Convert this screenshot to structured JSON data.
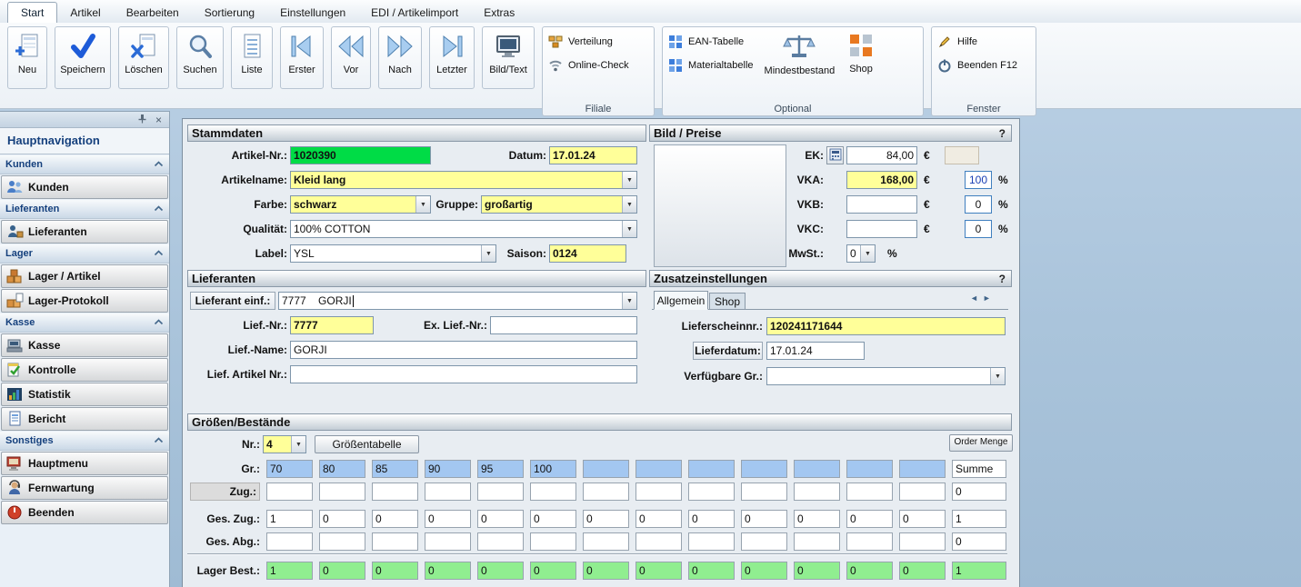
{
  "menu": {
    "items": [
      "Start",
      "Artikel",
      "Bearbeiten",
      "Sortierung",
      "Einstellungen",
      "EDI / Artikelimport",
      "Extras"
    ]
  },
  "ribbon": {
    "buttons": [
      {
        "label": "Neu",
        "icon": "new-form-icon"
      },
      {
        "label": "Speichern",
        "icon": "save-check-icon"
      },
      {
        "label": "Löschen",
        "icon": "delete-icon"
      },
      {
        "label": "Suchen",
        "icon": "search-icon"
      },
      {
        "label": "Liste",
        "icon": "list-icon"
      },
      {
        "label": "Erster",
        "icon": "first-record-icon"
      },
      {
        "label": "Vor",
        "icon": "previous-record-icon"
      },
      {
        "label": "Nach",
        "icon": "next-record-icon"
      },
      {
        "label": "Letzter",
        "icon": "last-record-icon"
      },
      {
        "label": "Bild/Text",
        "icon": "image-text-icon"
      }
    ],
    "groups": [
      {
        "caption": "Filiale",
        "items": [
          {
            "label": "Verteilung",
            "icon": "distribution-icon"
          },
          {
            "label": "Online-Check",
            "icon": "online-check-icon"
          }
        ]
      },
      {
        "caption": "Optional",
        "items": [
          {
            "label": "EAN-Tabelle",
            "icon": "ean-table-icon"
          },
          {
            "label": "Materialtabelle",
            "icon": "material-table-icon"
          },
          {
            "label": "Mindestbestand",
            "icon": "scales-icon"
          },
          {
            "label": "Shop",
            "icon": "shop-grid-icon"
          }
        ]
      },
      {
        "caption": "Fenster",
        "items": [
          {
            "label": "Hilfe",
            "icon": "help-pen-icon"
          },
          {
            "label": "Beenden F12",
            "icon": "power-icon"
          }
        ]
      }
    ]
  },
  "sidebar": {
    "title": "Hauptnavigation",
    "sections": [
      {
        "header": "Kunden",
        "items": [
          {
            "label": "Kunden",
            "icon": "customers-icon"
          }
        ]
      },
      {
        "header": "Lieferanten",
        "items": [
          {
            "label": "Lieferanten",
            "icon": "suppliers-icon"
          }
        ]
      },
      {
        "header": "Lager",
        "items": [
          {
            "label": "Lager / Artikel",
            "icon": "warehouse-icon"
          },
          {
            "label": "Lager-Protokoll",
            "icon": "warehouse-log-icon"
          }
        ]
      },
      {
        "header": "Kasse",
        "items": [
          {
            "label": "Kasse",
            "icon": "cash-register-icon"
          },
          {
            "label": "Kontrolle",
            "icon": "control-icon"
          },
          {
            "label": "Statistik",
            "icon": "statistics-icon"
          },
          {
            "label": "Bericht",
            "icon": "report-icon"
          }
        ]
      },
      {
        "header": "Sonstiges",
        "items": [
          {
            "label": "Hauptmenu",
            "icon": "main-menu-icon"
          },
          {
            "label": "Fernwartung",
            "icon": "remote-support-icon"
          },
          {
            "label": "Beenden",
            "icon": "quit-icon"
          }
        ]
      }
    ]
  },
  "stammdaten": {
    "title": "Stammdaten",
    "artikel_nr_label": "Artikel-Nr.:",
    "artikel_nr": "1020390",
    "datum_label": "Datum:",
    "datum": "17.01.24",
    "artikelname_label": "Artikelname:",
    "artikelname": "Kleid lang",
    "farbe_label": "Farbe:",
    "farbe": "schwarz",
    "gruppe_label": "Gruppe:",
    "gruppe": "großartig",
    "qualitaet_label": "Qualität:",
    "qualitaet": "100% COTTON",
    "label_label": "Label:",
    "label": "YSL",
    "saison_label": "Saison:",
    "saison": "0124"
  },
  "bild_preise": {
    "title": "Bild / Preise",
    "help": "?",
    "ek_label": "EK:",
    "ek": "84,00",
    "vka_label": "VKA:",
    "vka": "168,00",
    "vka_pct": "100",
    "vkb_label": "VKB:",
    "vkb": "",
    "vkb_pct": "0",
    "vkc_label": "VKC:",
    "vkc": "",
    "vkc_pct": "0",
    "mwst_label": "MwSt.:",
    "mwst": "0",
    "euro": "€",
    "percent": "%"
  },
  "lieferanten": {
    "title": "Lieferanten",
    "einf_label": "Lieferant einf.:",
    "einf_value": "7777    GORJI",
    "nr_label": "Lief.-Nr.:",
    "nr": "7777",
    "ex_nr_label": "Ex. Lief.-Nr.:",
    "ex_nr": "",
    "name_label": "Lief.-Name:",
    "name": "GORJI",
    "artikel_nr_label": "Lief. Artikel Nr.:",
    "artikel_nr": ""
  },
  "zusatz": {
    "title": "Zusatzeinstellungen",
    "help": "?",
    "tab_allgemein": "Allgemein",
    "tab_shop": "Shop",
    "lieferschein_label": "Lieferscheinnr.:",
    "lieferschein": "120241171644",
    "lieferdatum_label": "Lieferdatum:",
    "lieferdatum": "17.01.24",
    "verfuegbar_label": "Verfügbare Gr.:",
    "verfuegbar": ""
  },
  "groessen": {
    "title": "Größen/Bestände",
    "nr_label": "Nr.:",
    "nr": "4",
    "groessentabelle_button": "Größentabelle",
    "order_menge_button": "Order Menge",
    "grid_rows": [
      {
        "label": "Gr.:",
        "cell_style": "blue",
        "cells": [
          "70",
          "80",
          "85",
          "90",
          "95",
          "100",
          "",
          "",
          "",
          "",
          "",
          "",
          ""
        ],
        "summe": "Summe",
        "summe_style": "header"
      },
      {
        "label": "Zug.:",
        "cell_style": "white",
        "label_boxed": true,
        "cells": [
          "",
          "",
          "",
          "",
          "",
          "",
          "",
          "",
          "",
          "",
          "",
          "",
          ""
        ],
        "summe": "0",
        "summe_style": "white"
      },
      {
        "label": "Ges. Zug.:",
        "cell_style": "white",
        "cells": [
          "1",
          "0",
          "0",
          "0",
          "0",
          "0",
          "0",
          "0",
          "0",
          "0",
          "0",
          "0",
          "0"
        ],
        "summe": "1",
        "summe_style": "white"
      },
      {
        "label": "Ges. Abg.:",
        "cell_style": "white",
        "cells": [
          "",
          "",
          "",
          "",
          "",
          "",
          "",
          "",
          "",
          "",
          "",
          "",
          ""
        ],
        "summe": "0",
        "summe_style": "white"
      },
      {
        "label": "Lager Best.:",
        "cell_style": "green",
        "separated": true,
        "cells": [
          "1",
          "0",
          "0",
          "0",
          "0",
          "0",
          "0",
          "0",
          "0",
          "0",
          "0",
          "0",
          "0"
        ],
        "summe": "1",
        "summe_style": "green"
      }
    ]
  }
}
